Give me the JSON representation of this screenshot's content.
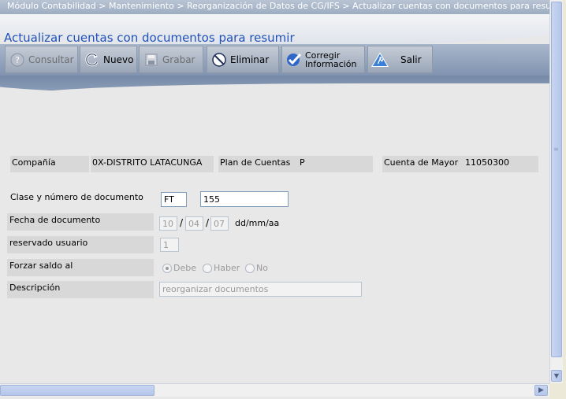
{
  "breadcrumb": "Módulo Contabilidad > Mantenimiento > Reorganización de Datos de CG/IFS > Actualizar cuentas con documentos para resumir",
  "page_title": "Actualizar cuentas con documentos para resumir",
  "toolbar": {
    "consultar": "Consultar",
    "nuevo": "Nuevo",
    "grabar": "Grabar",
    "eliminar": "Eliminar",
    "corregir_line1": "Corregir",
    "corregir_line2": "Información",
    "salir": "Salir"
  },
  "header_info": {
    "company_label": "Compañía",
    "company_value": "0X-DISTRITO LATACUNGA",
    "plan_label": "Plan de Cuentas",
    "plan_value": "P",
    "account_label": "Cuenta de Mayor",
    "account_value": "11050300"
  },
  "form": {
    "doc_label": "Clase y número de documento",
    "doc_class": "FT",
    "doc_number": "155",
    "date_label": "Fecha de documento",
    "date_day": "10",
    "date_sep": "/",
    "date_month": "04",
    "date_year": "07",
    "date_format": "dd/mm/aa",
    "reserved_label": "reservado usuario",
    "reserved_value": "1",
    "balance_label": "Forzar saldo al",
    "balance_options": [
      "Debe",
      "Haber",
      "No"
    ],
    "balance_selected": "Debe",
    "description_label": "Descripción",
    "description_value": "reorganizar documentos"
  },
  "colors": {
    "title": "#2152b8",
    "toolbar": "#8f9fb8",
    "label_bg": "#d8d8d8",
    "page_bg": "#e8e8e8"
  },
  "icons": [
    "help-icon",
    "refresh-icon",
    "save-icon",
    "prohibit-icon",
    "check-icon",
    "exit-icon"
  ]
}
